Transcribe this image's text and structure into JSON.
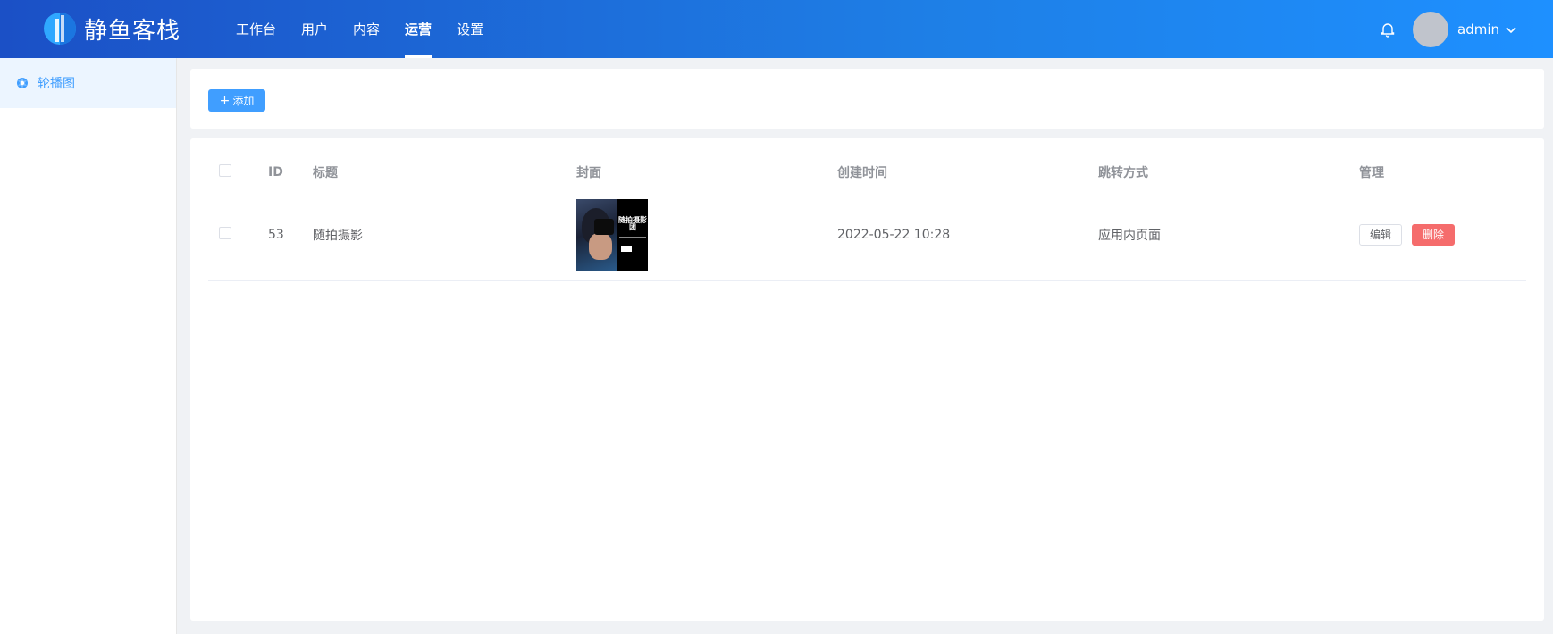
{
  "brand": {
    "name": "静鱼客栈"
  },
  "nav": {
    "items": [
      {
        "label": "工作台"
      },
      {
        "label": "用户"
      },
      {
        "label": "内容"
      },
      {
        "label": "运营"
      },
      {
        "label": "设置"
      }
    ],
    "active": "运营"
  },
  "user": {
    "name": "admin"
  },
  "sidebar": {
    "items": [
      {
        "label": "轮播图",
        "icon": "carousel-icon"
      }
    ]
  },
  "toolbar": {
    "add_label": "添加"
  },
  "table": {
    "columns": [
      "ID",
      "标题",
      "封面",
      "创建时间",
      "跳转方式",
      "管理"
    ],
    "rows": [
      {
        "id": "53",
        "title": "随拍摄影",
        "cover_text": "随拍摄影团",
        "created": "2022-05-22 10:28",
        "jump": "应用内页面",
        "edit_label": "编辑",
        "delete_label": "删除"
      }
    ]
  },
  "colors": {
    "primary": "#409eff",
    "danger": "#f56c6c",
    "header_start": "#1b50c6",
    "header_end": "#1e90ff"
  }
}
